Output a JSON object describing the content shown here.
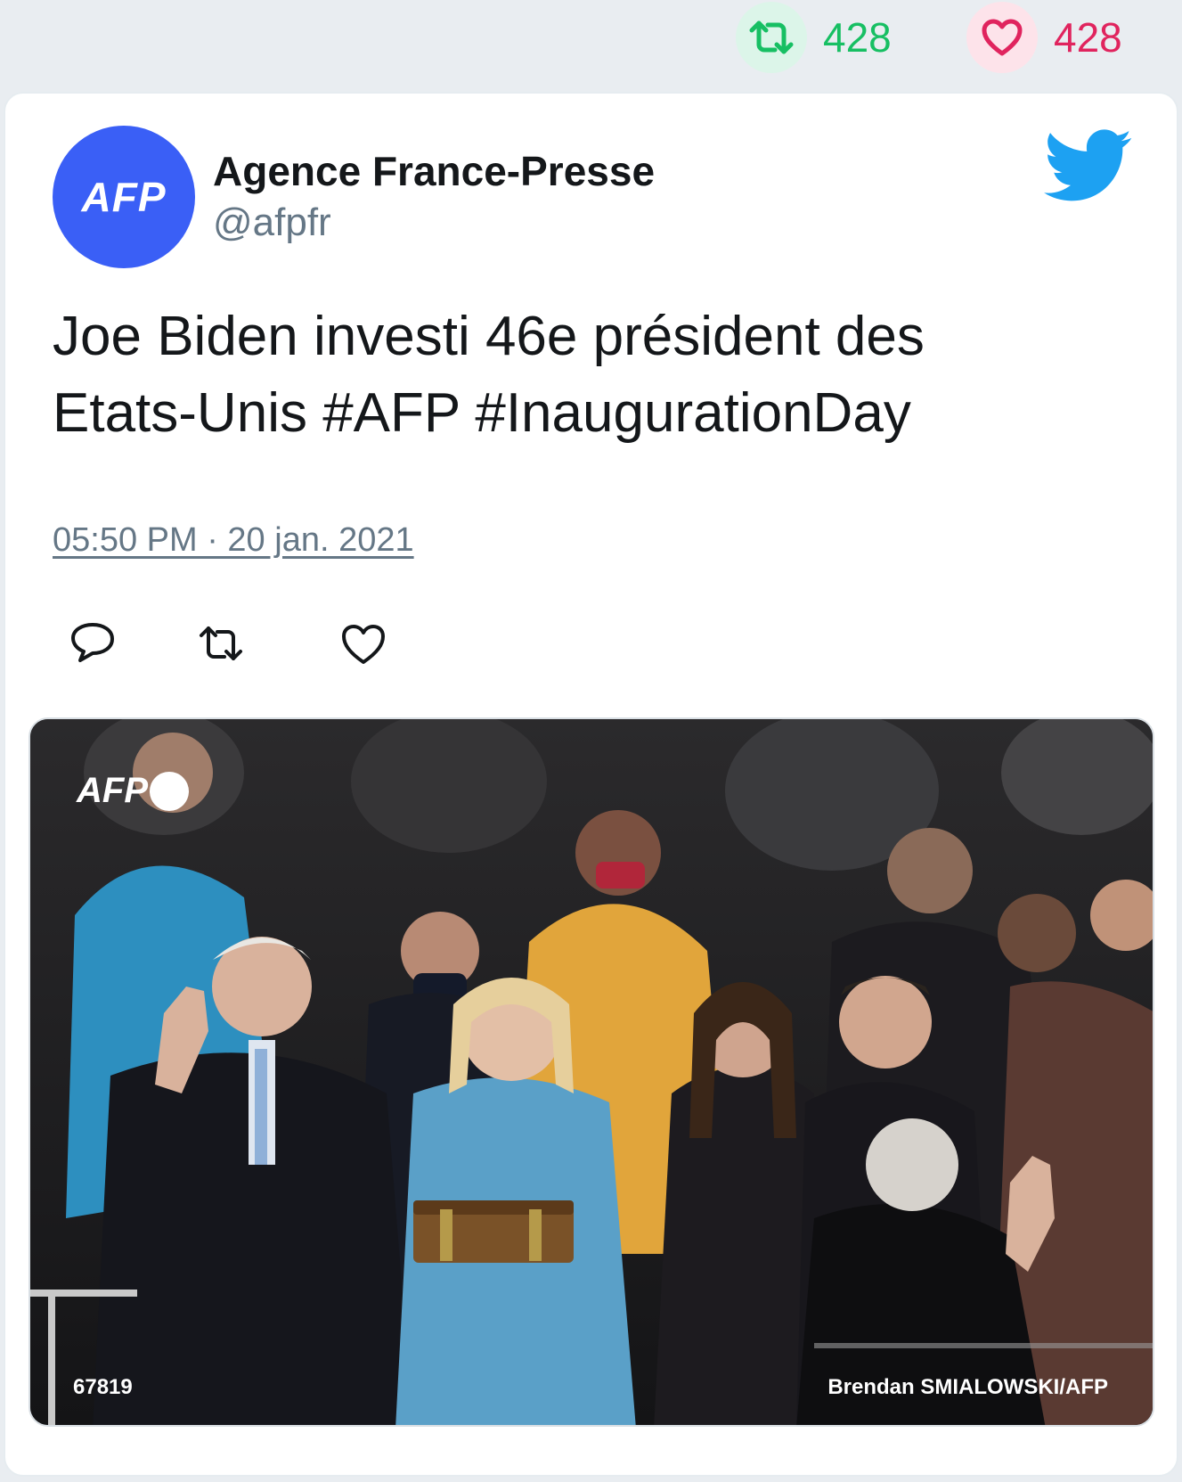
{
  "stats": {
    "retweet_count": "428",
    "like_count": "428",
    "retweet_icon": "retweet-icon",
    "like_icon": "heart-icon"
  },
  "tweet": {
    "avatar_text": "AFP",
    "author_name": "Agence France-Presse",
    "handle": "@afpfr",
    "text_line1": "Joe Biden investi 46e président des",
    "text_line2": "Etats-Unis #AFP #InaugurationDay",
    "timestamp": "05:50 PM · 20 jan. 2021",
    "brand_icon": "twitter-bird-icon"
  },
  "media": {
    "watermark": "AFP",
    "photo_id": "67819",
    "credit": "Brendan SMIALOWSKI/AFP"
  },
  "colors": {
    "background": "#e9edf1",
    "retweet_green": "#17bf63",
    "like_red": "#e0245e",
    "twitter_blue": "#1da1f2",
    "afp_blue": "#3a5ff6"
  }
}
